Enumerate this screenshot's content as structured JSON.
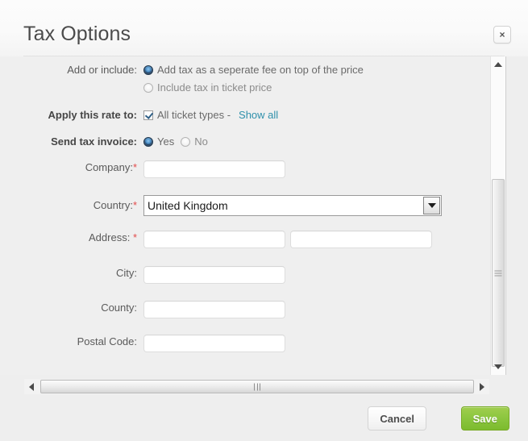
{
  "dialog": {
    "title": "Tax Options",
    "close_label": "×"
  },
  "form": {
    "add_or_include": {
      "label": "Add or include:",
      "options": [
        {
          "text": "Add tax as a seperate fee on top of the price",
          "selected": true
        },
        {
          "text": "Include tax in ticket price",
          "selected": false
        }
      ]
    },
    "apply_rate": {
      "label": "Apply this rate to:",
      "checkbox_label": "All ticket types -",
      "checked": true,
      "link_label": "Show all"
    },
    "send_invoice": {
      "label": "Send tax invoice:",
      "options": [
        {
          "text": "Yes",
          "selected": true
        },
        {
          "text": "No",
          "selected": false
        }
      ]
    },
    "company": {
      "label": "Company:",
      "required": "*",
      "value": "",
      "placeholder": ""
    },
    "country": {
      "label": "Country:",
      "required": "*",
      "value": "United Kingdom"
    },
    "address": {
      "label": "Address:",
      "required": "*",
      "value_line1": "",
      "value_line2": "",
      "placeholder": ""
    },
    "city": {
      "label": "City:",
      "value": "",
      "placeholder": ""
    },
    "county": {
      "label": "County:",
      "value": "",
      "placeholder": ""
    },
    "postal_code": {
      "label": "Postal Code:",
      "value": "",
      "placeholder": ""
    }
  },
  "footer": {
    "cancel_label": "Cancel",
    "save_label": "Save"
  },
  "colors": {
    "accent_green": "#8cc63f",
    "link_blue": "#2f90ab",
    "required_red": "#e24b4b",
    "radio_selected": "#1d3b5c"
  }
}
